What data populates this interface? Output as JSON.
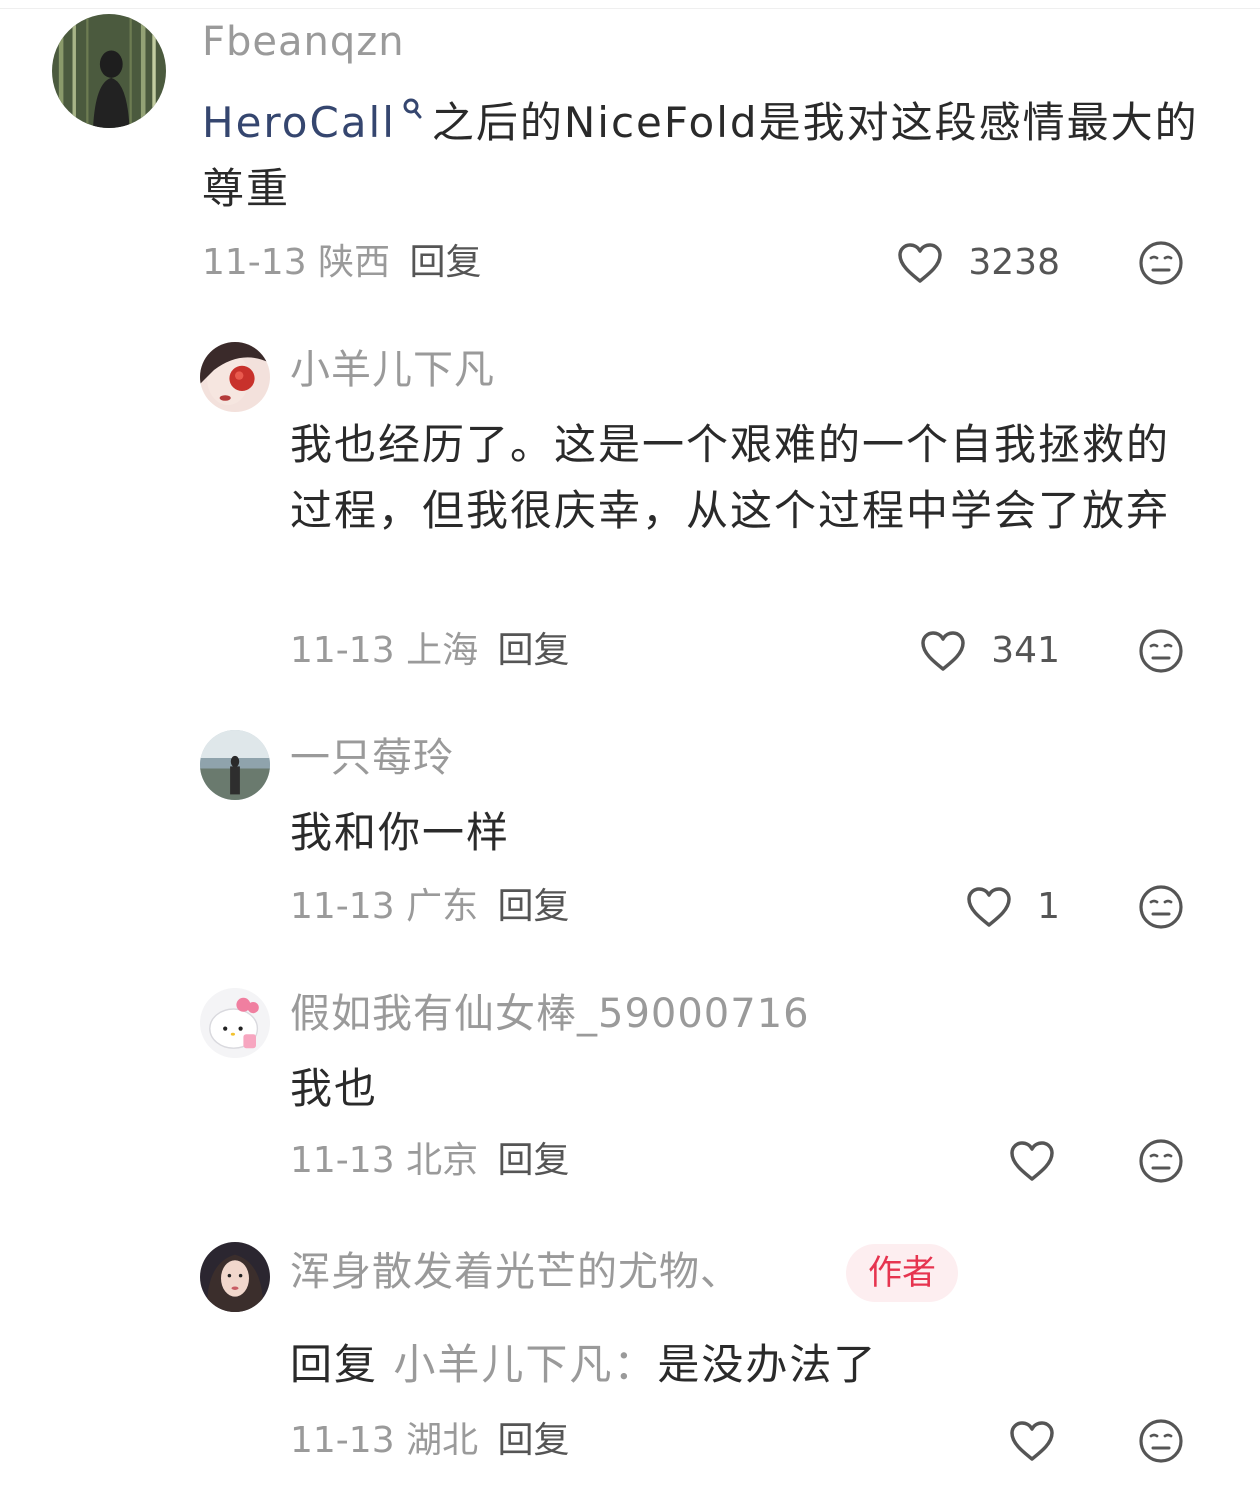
{
  "comments": [
    {
      "username": "Fbeanqzn",
      "content_topic": "HeroCall",
      "content_text": "之后的NiceFold是我对这段感情最大的尊重",
      "date": "11-13",
      "location": "陕西",
      "reply_label": "回复",
      "likes": "3238"
    },
    {
      "username": "小羊儿下凡",
      "content_text": "我也经历了。这是一个艰难的一个自我拯救的过程，但我很庆幸，从这个过程中学会了放弃",
      "date": "11-13",
      "location": "上海",
      "reply_label": "回复",
      "likes": "341"
    },
    {
      "username": "一只莓玲",
      "content_text": "我和你一样",
      "date": "11-13",
      "location": "广东",
      "reply_label": "回复",
      "likes": "1"
    },
    {
      "username": "假如我有仙女棒_59000716",
      "content_text": "我也",
      "date": "11-13",
      "location": "北京",
      "reply_label": "回复",
      "likes": ""
    },
    {
      "username": "浑身散发着光芒的尤物、",
      "badge": "作者",
      "content_reply_prefix": "回复",
      "content_mention": "小羊儿下凡：",
      "content_text": "是没办法了",
      "date": "11-13",
      "location": "湖北",
      "reply_label": "回复",
      "likes": ""
    }
  ],
  "icons": {
    "like": "heart-outline-icon",
    "dislike": "neutral-face-icon",
    "topic_search": "search-icon"
  },
  "colors": {
    "topic": "#35466f",
    "badge_text": "#e6344f",
    "badge_bg": "#fdeef0",
    "meta": "#9a9a9a"
  }
}
